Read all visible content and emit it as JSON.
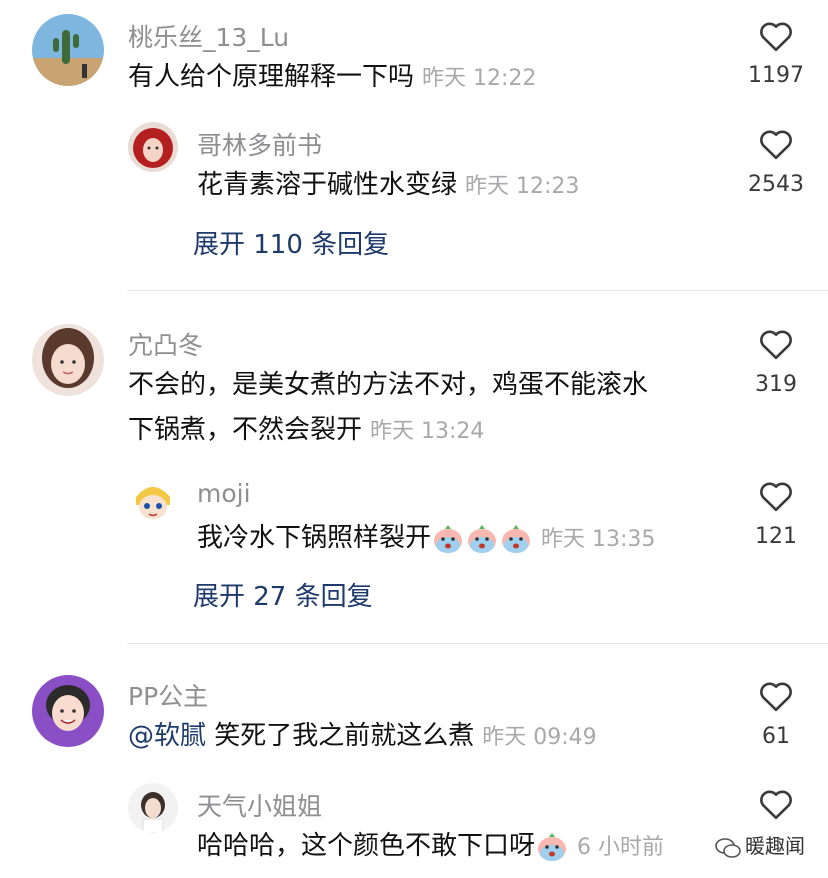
{
  "comments": [
    {
      "username": "桃乐丝_13_Lu",
      "text": "有人给个原理解释一下吗",
      "time": "昨天 12:22",
      "likes": "1197",
      "replies": [
        {
          "username": "哥林多前书",
          "text": "花青素溶于碱性水变绿",
          "time": "昨天 12:23",
          "likes": "2543"
        }
      ],
      "expand_label": "展开 110 条回复"
    },
    {
      "username": "宂凸冬",
      "text_line1": "不会的，是美女煮的方法不对，鸡蛋不能滚水",
      "text_line2": "下锅煮，不然会裂开",
      "time": "昨天 13:24",
      "likes": "319",
      "replies": [
        {
          "username": "moji",
          "text": "我冷水下锅照样裂开",
          "time": "昨天 13:35",
          "likes": "121",
          "emoji_count": 3
        }
      ],
      "expand_label": "展开 27 条回复"
    },
    {
      "username": "PP公主",
      "mention": "@软腻",
      "text": " 笑死了我之前就这么煮",
      "time": "昨天 09:49",
      "likes": "61",
      "replies": [
        {
          "username": "天气小姐姐",
          "text": "哈哈哈，这个颜色不敢下口呀",
          "time": "6 小时前"
        }
      ]
    }
  ],
  "watermark": "暖趣闻",
  "colors": {
    "expand_link": "#1d3a6b",
    "meta_gray": "#8e8e93",
    "divider": "#e6e6e8"
  },
  "icons": {
    "like": "heart-outline-icon",
    "emoji": "crying-peach-emoji",
    "watermark": "wechat-logo-icon"
  }
}
